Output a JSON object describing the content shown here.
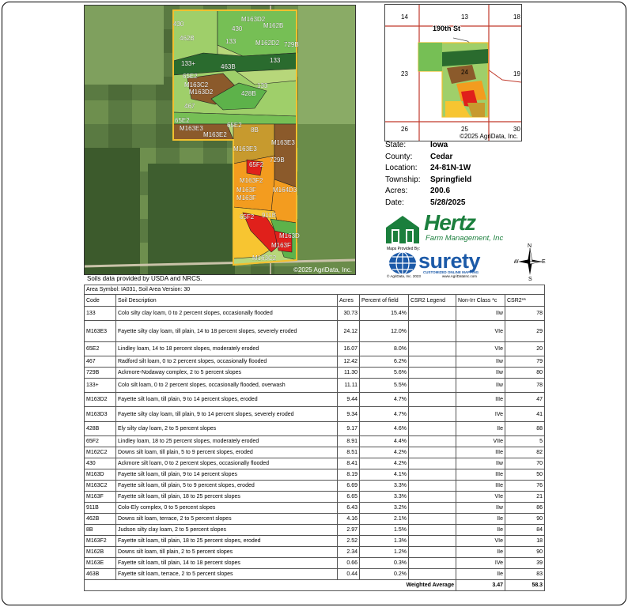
{
  "aerial": {
    "copyright": "©2025 AgriData, Inc.",
    "soil_labels": [
      "430",
      "M163D2",
      "M162B",
      "430",
      "133",
      "M162D2",
      "729B",
      "462B",
      "133",
      "133+",
      "463B",
      "65E2",
      "M163C2",
      "M163D2",
      "133",
      "428B",
      "467",
      "65E2",
      "M163E3",
      "M163E2",
      "65E2",
      "8B",
      "M163E3",
      "M163E3",
      "65F2",
      "729B",
      "M163F2",
      "M163F",
      "M163F",
      "M164D3",
      "65F2",
      "911B",
      "M163D",
      "M163F",
      "M163C2"
    ]
  },
  "usda_note": "Soils data provided by USDA and NRCS.",
  "inset": {
    "sections": [
      "14",
      "13",
      "18",
      "23",
      "24",
      "19",
      "26",
      "25",
      "30"
    ],
    "road": "190th St",
    "copyright": "©2025 AgriData, Inc."
  },
  "info": [
    {
      "k": "State:",
      "v": "Iowa"
    },
    {
      "k": "County:",
      "v": "Cedar"
    },
    {
      "k": "Location:",
      "v": "24-81N-1W"
    },
    {
      "k": "Township:",
      "v": "Springfield"
    },
    {
      "k": "Acres:",
      "v": "200.6"
    },
    {
      "k": "Date:",
      "v": "5/28/2025"
    }
  ],
  "hertz": {
    "name": "Hertz",
    "sub": "Farm Management, Inc"
  },
  "surety": {
    "maps_by": "Maps Provided By:",
    "name": "surety",
    "tagline": "CUSTOMIZED ONLINE MAPPING",
    "copy": "© AgriData, Inc. 2023",
    "url": "www.AgriDataInc.com"
  },
  "compass": {
    "n": "N",
    "e": "E",
    "s": "S",
    "w": "W"
  },
  "table": {
    "area_symbol": "Area Symbol: IA031, Soil Area Version: 30",
    "headers": [
      "Code",
      "Soil Description",
      "Acres",
      "Percent of field",
      "CSR2 Legend",
      "Non-Irr Class *c",
      "CSR2**"
    ],
    "rows": [
      {
        "code": "133",
        "desc": "Colo silty clay loam, 0 to 2 percent slopes, occasionally flooded",
        "acres": "30.73",
        "pct": "15.4%",
        "color": "#9fcf6a",
        "cls": "IIw",
        "csr": "78"
      },
      {
        "code": "M163E3",
        "desc": "Fayette silty clay loam, till plain, 14 to 18 percent slopes, severely eroded",
        "acres": "24.12",
        "pct": "12.0%",
        "color": "#8b5a2b",
        "cls": "VIe",
        "csr": "29"
      },
      {
        "code": "65E2",
        "desc": "Lindley loam, 14 to 18 percent slopes, moderately eroded",
        "acres": "16.07",
        "pct": "8.0%",
        "color": "#8b5a2b",
        "cls": "VIe",
        "csr": "20"
      },
      {
        "code": "467",
        "desc": "Radford silt loam, 0 to 2 percent slopes, occasionally flooded",
        "acres": "12.42",
        "pct": "6.2%",
        "color": "#9fcf6a",
        "cls": "IIw",
        "csr": "79"
      },
      {
        "code": "729B",
        "desc": "Ackmore-Nodaway complex, 2 to 5 percent slopes",
        "acres": "11.30",
        "pct": "5.6%",
        "color": "#5db24a",
        "cls": "IIw",
        "csr": "80"
      },
      {
        "code": "133+",
        "desc": "Colo silt loam, 0 to 2 percent slopes, occasionally flooded, overwash",
        "acres": "11.11",
        "pct": "5.5%",
        "color": "#9fcf6a",
        "cls": "IIw",
        "csr": "78"
      },
      {
        "code": "M163D2",
        "desc": "Fayette silt loam, till plain, 9 to 14 percent slopes, eroded",
        "acres": "9.44",
        "pct": "4.7%",
        "color": "#f39c1f",
        "cls": "IIIe",
        "csr": "47"
      },
      {
        "code": "M163D3",
        "desc": "Fayette silty clay loam, till plain, 9 to 14 percent slopes, severely eroded",
        "acres": "9.34",
        "pct": "4.7%",
        "color": "#f39c1f",
        "cls": "IVe",
        "csr": "41"
      },
      {
        "code": "428B",
        "desc": "Ely silty clay loam, 2 to 5 percent slopes",
        "acres": "9.17",
        "pct": "4.6%",
        "color": "#2e8b3c",
        "cls": "IIe",
        "csr": "88"
      },
      {
        "code": "65F2",
        "desc": "Lindley loam, 18 to 25 percent slopes, moderately eroded",
        "acres": "8.91",
        "pct": "4.4%",
        "color": "#e0201b",
        "cls": "VIIe",
        "csr": "5"
      },
      {
        "code": "M162C2",
        "desc": "Downs silt loam, till plain, 5 to 9 percent slopes, eroded",
        "acres": "8.51",
        "pct": "4.2%",
        "color": "#5db24a",
        "cls": "IIIe",
        "csr": "82"
      },
      {
        "code": "430",
        "desc": "Ackmore silt loam, 0 to 2 percent slopes, occasionally flooded",
        "acres": "8.41",
        "pct": "4.2%",
        "color": "#76bf55",
        "cls": "IIw",
        "csr": "70"
      },
      {
        "code": "M163D",
        "desc": "Fayette silt loam, till plain, 9 to 14 percent slopes",
        "acres": "8.19",
        "pct": "4.1%",
        "color": "#f7c531",
        "cls": "IIIe",
        "csr": "50"
      },
      {
        "code": "M163C2",
        "desc": "Fayette silt loam, till plain, 5 to 9 percent slopes, eroded",
        "acres": "6.69",
        "pct": "3.3%",
        "color": "#76bf55",
        "cls": "IIIe",
        "csr": "76"
      },
      {
        "code": "M163F",
        "desc": "Fayette silt loam, till plain, 18 to 25 percent slopes",
        "acres": "6.65",
        "pct": "3.3%",
        "color": "#8b5a2b",
        "cls": "VIe",
        "csr": "21"
      },
      {
        "code": "911B",
        "desc": "Colo-Ely complex, 0 to 5 percent slopes",
        "acres": "6.43",
        "pct": "3.2%",
        "color": "#3f9c3f",
        "cls": "IIw",
        "csr": "86"
      },
      {
        "code": "462B",
        "desc": "Downs silt loam, terrace, 2 to 5 percent slopes",
        "acres": "4.16",
        "pct": "2.1%",
        "color": "#2a6b2e",
        "cls": "IIe",
        "csr": "90"
      },
      {
        "code": "8B",
        "desc": "Judson silty clay loam, 2 to 5 percent slopes",
        "acres": "2.97",
        "pct": "1.5%",
        "color": "#3f9c3f",
        "cls": "IIe",
        "csr": "84"
      },
      {
        "code": "M163F2",
        "desc": "Fayette silt loam, till plain, 18 to 25 percent slopes, eroded",
        "acres": "2.52",
        "pct": "1.3%",
        "color": "#e0201b",
        "cls": "VIe",
        "csr": "18"
      },
      {
        "code": "M162B",
        "desc": "Downs silt loam, till plain, 2 to 5 percent slopes",
        "acres": "2.34",
        "pct": "1.2%",
        "color": "#2a6b2e",
        "cls": "IIe",
        "csr": "90"
      },
      {
        "code": "M163E",
        "desc": "Fayette silt loam, till plain, 14 to 18 percent slopes",
        "acres": "0.66",
        "pct": "0.3%",
        "color": "#c79a2e",
        "cls": "IVe",
        "csr": "39"
      },
      {
        "code": "463B",
        "desc": "Fayette silt loam, terrace, 2 to 5 percent slopes",
        "acres": "0.44",
        "pct": "0.2%",
        "color": "#3f9c3f",
        "cls": "IIe",
        "csr": "83"
      }
    ],
    "weighted_label": "Weighted Average",
    "weighted_class": "3.47",
    "weighted_csr": "58.3"
  }
}
